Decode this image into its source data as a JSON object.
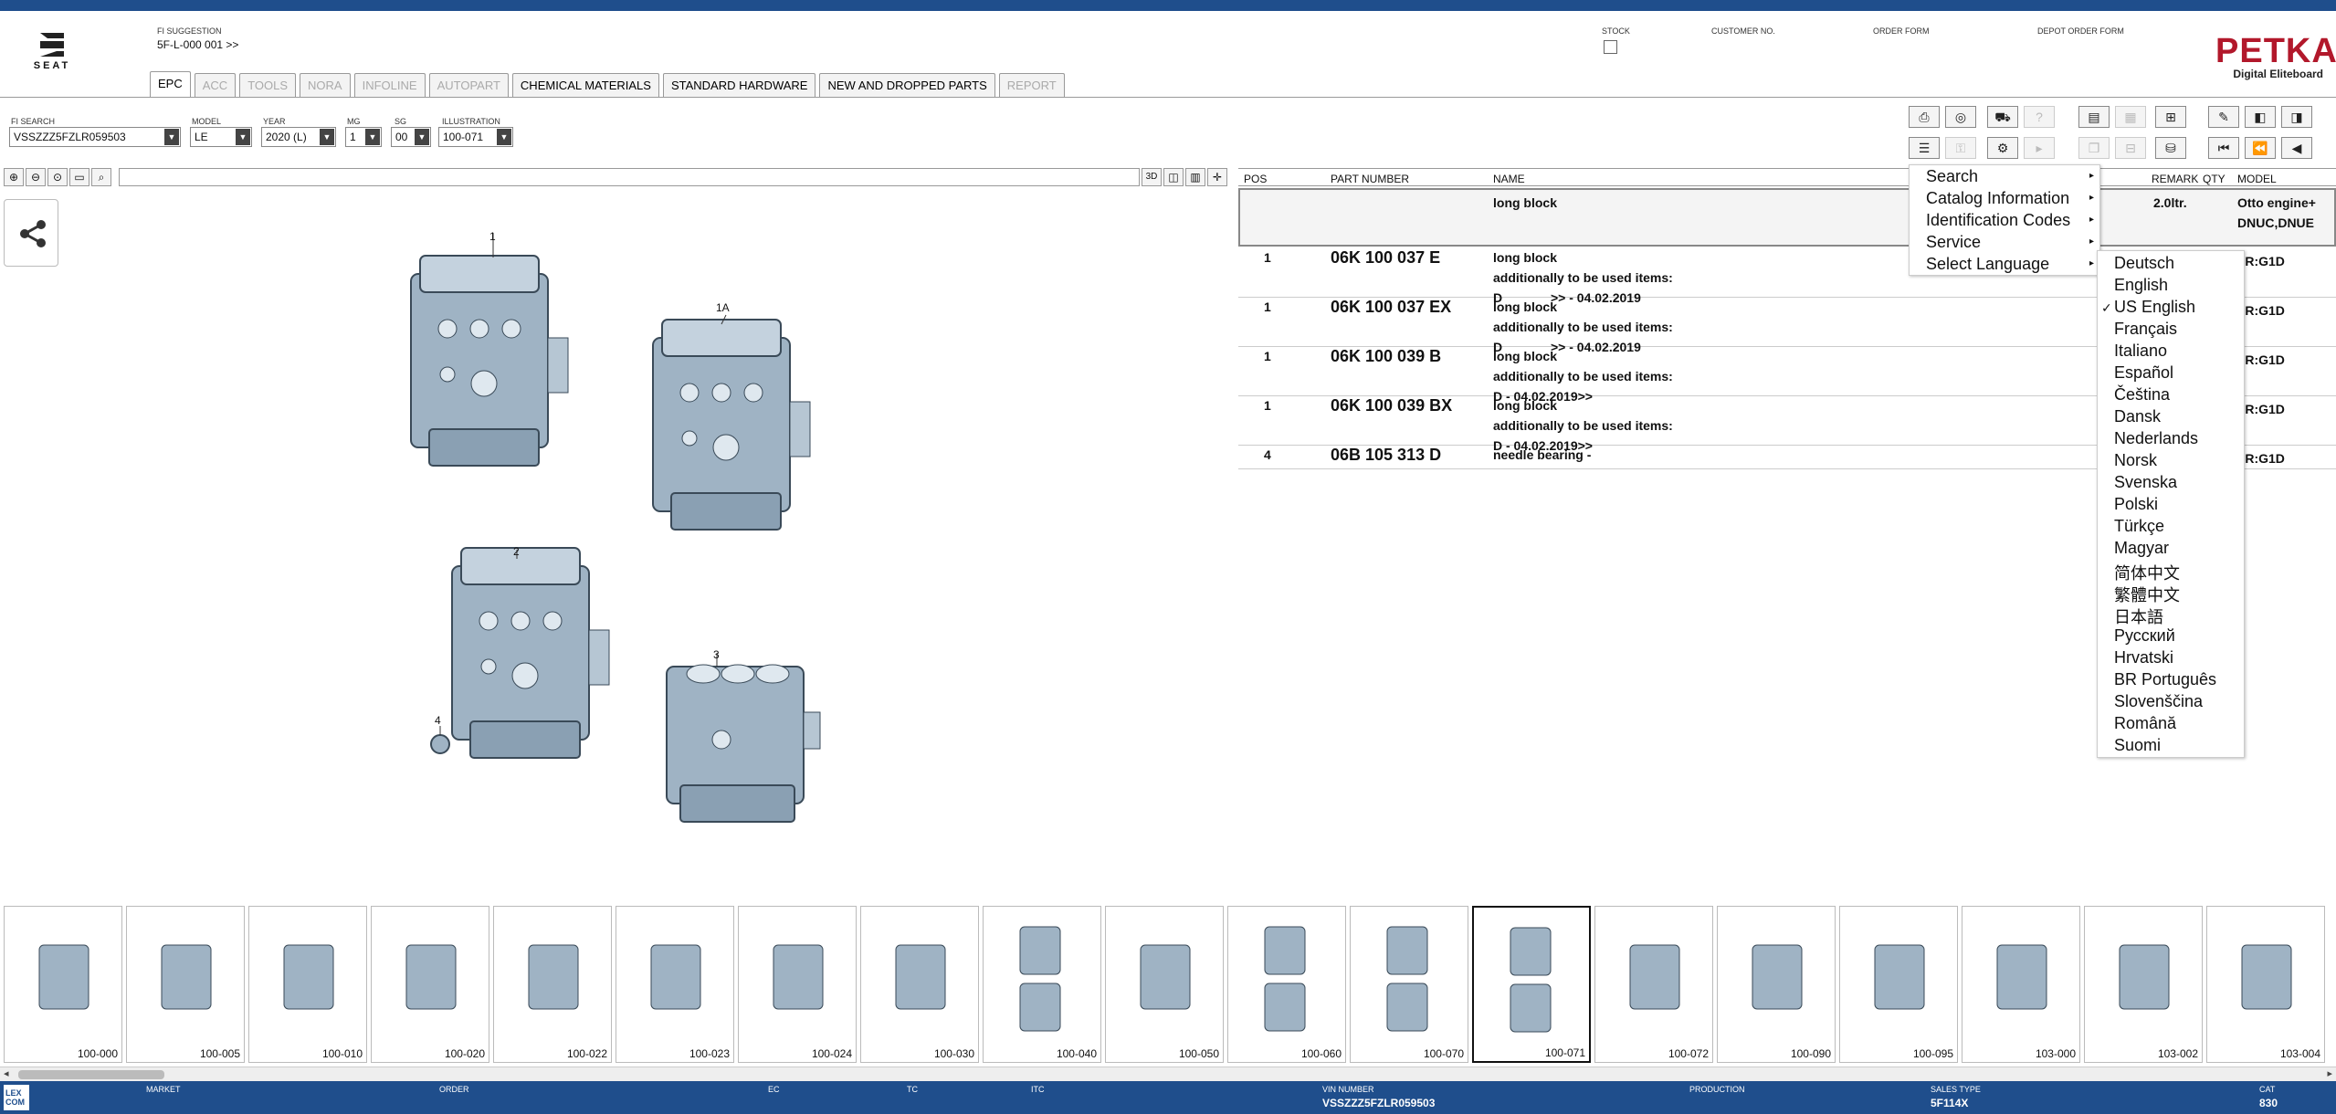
{
  "header": {
    "brand": "SEAT",
    "fi_suggestion_label": "FI SUGGESTION",
    "fi_suggestion_value": "5F-L-000 001 >>",
    "stock_label": "STOCK",
    "customer_no_label": "CUSTOMER NO.",
    "order_form_label": "ORDER FORM",
    "depot_order_form_label": "DEPOT ORDER FORM",
    "petka_title": "PETKA",
    "petka_subtitle": "Digital Eliteboard"
  },
  "tabs": [
    {
      "label": "EPC",
      "state": "active"
    },
    {
      "label": "ACC",
      "state": "disabled"
    },
    {
      "label": "TOOLS",
      "state": "disabled"
    },
    {
      "label": "NORA",
      "state": "disabled"
    },
    {
      "label": "INFOLINE",
      "state": "disabled"
    },
    {
      "label": "AUTOPART",
      "state": "disabled"
    },
    {
      "label": "CHEMICAL MATERIALS",
      "state": "enabled"
    },
    {
      "label": "STANDARD HARDWARE",
      "state": "enabled"
    },
    {
      "label": "NEW AND DROPPED PARTS",
      "state": "enabled"
    },
    {
      "label": "REPORT",
      "state": "disabled"
    }
  ],
  "search": {
    "fi_search_label": "FI SEARCH",
    "fi_search_value": "VSSZZZ5FZLR059503",
    "model_label": "MODEL",
    "model_value": "LE",
    "year_label": "YEAR",
    "year_value": "2020 (L)",
    "mg_label": "MG",
    "mg_value": "1",
    "sg_label": "SG",
    "sg_value": "00",
    "illustration_label": "ILLUSTRATION",
    "illustration_value": "100-071"
  },
  "viewer": {
    "toolbar_3d": "3D",
    "callouts": [
      "1",
      "1A",
      "2",
      "3",
      "4"
    ]
  },
  "table": {
    "headers": {
      "pos": "POS",
      "part_number": "PART NUMBER",
      "name": "NAME",
      "remark": "REMARK",
      "qty": "QTY",
      "model": "MODEL"
    },
    "header_row": {
      "name": "long block",
      "remark": "2.0ltr.",
      "model_line1": "Otto engine+",
      "model_line2": "DNUC,DNUE"
    },
    "rows": [
      {
        "pos": "1",
        "part": "06K 100 037 E",
        "name": "long block",
        "line2": "additionally to be used items:",
        "line3_a": "D",
        "line3_b": ">> - 04.02.2019",
        "model": "PR:G1D"
      },
      {
        "pos": "1",
        "part": "06K 100 037 EX",
        "name": "long block",
        "line2": "additionally to be used items:",
        "line3_a": "D",
        "line3_b": ">> - 04.02.2019",
        "model": "PR:G1D"
      },
      {
        "pos": "1",
        "part": "06K 100 039 B",
        "name": "long block",
        "line2": "additionally to be used items:",
        "line3_a": "D - 04.02.2019>>",
        "line3_b": "",
        "model": "PR:G1D"
      },
      {
        "pos": "1",
        "part": "06K 100 039 BX",
        "name": "long block",
        "line2": "additionally to be used items:",
        "line3_a": "D - 04.02.2019>>",
        "line3_b": "",
        "model": "PR:G1D"
      },
      {
        "pos": "4",
        "part": "06B 105 313 D",
        "name": "needle bearing -",
        "line2": "",
        "line3_a": "",
        "line3_b": "",
        "model": "PR:G1D"
      }
    ]
  },
  "context_menu": {
    "items": [
      "Search",
      "Catalog Information",
      "Identification Codes",
      "Service",
      "Select Language"
    ]
  },
  "languages": {
    "selected": "US English",
    "items": [
      "Deutsch",
      "English",
      "US English",
      "Français",
      "Italiano",
      "Español",
      "Čeština",
      "Dansk",
      "Nederlands",
      "Norsk",
      "Svenska",
      "Polski",
      "Türkçe",
      "Magyar",
      "简体中文",
      "繁體中文",
      "日本語",
      "Русский",
      "Hrvatski",
      "BR Português",
      "Slovenščina",
      "Română",
      "Suomi"
    ]
  },
  "thumbnails": [
    {
      "label": "100-000"
    },
    {
      "label": "100-005"
    },
    {
      "label": "100-010"
    },
    {
      "label": "100-020"
    },
    {
      "label": "100-022"
    },
    {
      "label": "100-023"
    },
    {
      "label": "100-024"
    },
    {
      "label": "100-030"
    },
    {
      "label": "100-040"
    },
    {
      "label": "100-050"
    },
    {
      "label": "100-060"
    },
    {
      "label": "100-070"
    },
    {
      "label": "100-071",
      "selected": true
    },
    {
      "label": "100-072"
    },
    {
      "label": "100-090"
    },
    {
      "label": "100-095"
    },
    {
      "label": "103-000"
    },
    {
      "label": "103-002"
    },
    {
      "label": "103-004"
    }
  ],
  "status": {
    "market_label": "MARKET",
    "order_label": "ORDER",
    "ec_label": "EC",
    "tc_label": "TC",
    "itc_label": "ITC",
    "vin_label": "VIN NUMBER",
    "vin_value": "VSSZZZ5FZLR059503",
    "production_label": "PRODUCTION",
    "sales_type_label": "SALES TYPE",
    "sales_type_value": "5F114X",
    "cat_label": "CAT",
    "cat_value": "830",
    "lexcom_line1": "LEX",
    "lexcom_line2": "COM"
  },
  "colors": {
    "accent": "#1f4e8c",
    "brand_red": "#b2182b",
    "engine": "#9fb3c4"
  }
}
